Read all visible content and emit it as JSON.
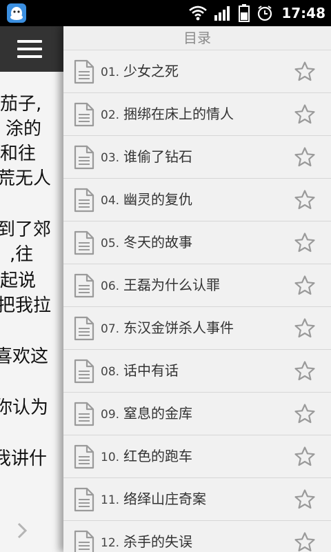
{
  "statusbar": {
    "time": "17:48",
    "icons": [
      "qq-app-icon",
      "wifi-icon",
      "signal-icon",
      "battery-icon",
      "alarm-icon"
    ]
  },
  "reader": {
    "menu_icon": "hamburger-menu-icon",
    "text_lines": [
      "茄子,",
      "涂的",
      "和往",
      "荒无人",
      "",
      "到了郊",
      ",往",
      "起说",
      "把我拉",
      "",
      "喜欢这",
      "",
      "你认为",
      "",
      "我讲什"
    ],
    "next_icon": "chevron-right-icon"
  },
  "toc": {
    "title": "目录",
    "chapters": [
      {
        "num": "01.",
        "title": "少女之死"
      },
      {
        "num": "02.",
        "title": "捆绑在床上的情人"
      },
      {
        "num": "03.",
        "title": "谁偷了钻石"
      },
      {
        "num": "04.",
        "title": "幽灵的复仇"
      },
      {
        "num": "05.",
        "title": "冬天的故事"
      },
      {
        "num": "06.",
        "title": "王磊为什么认罪"
      },
      {
        "num": "07.",
        "title": "东汉金饼杀人事件"
      },
      {
        "num": "08.",
        "title": "话中有话"
      },
      {
        "num": "09.",
        "title": "窒息的金库"
      },
      {
        "num": "10.",
        "title": "红色的跑车"
      },
      {
        "num": "11.",
        "title": "络绎山庄奇案"
      },
      {
        "num": "12.",
        "title": "杀手的失误"
      }
    ]
  },
  "colors": {
    "statusbar": "#000000",
    "menu_bar": "#333333",
    "toc_bg": "#efefef",
    "icon_gray": "#9a9a9a"
  }
}
